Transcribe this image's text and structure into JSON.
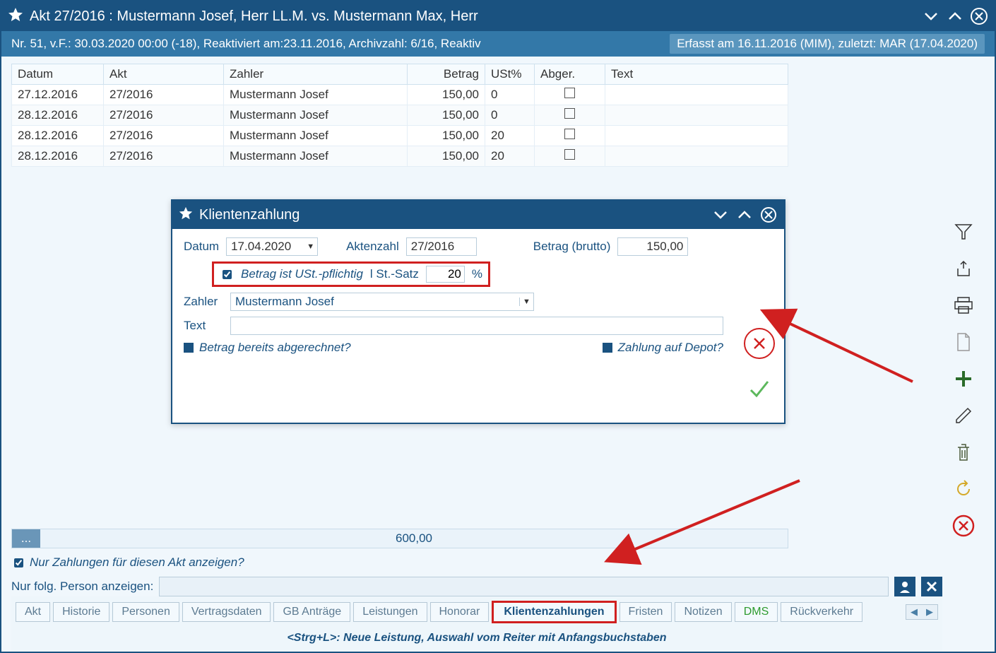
{
  "window": {
    "title": "Akt 27/2016 : Mustermann Josef, Herr  LL.M. vs. Mustermann Max, Herr",
    "subtitle_left": "Nr. 51, v.F.: 30.03.2020 00:00 (-18), Reaktiviert am:23.11.2016, Archivzahl: 6/16, Reaktiv",
    "subtitle_right": "Erfasst am 16.11.2016 (MIM), zuletzt: MAR (17.04.2020)"
  },
  "table": {
    "headers": {
      "datum": "Datum",
      "akt": "Akt",
      "zahler": "Zahler",
      "betrag": "Betrag",
      "ust": "USt%",
      "abger": "Abger.",
      "text": "Text"
    },
    "rows": [
      {
        "datum": "27.12.2016",
        "akt": "27/2016",
        "zahler": "Mustermann Josef",
        "betrag": "150,00",
        "ust": "0",
        "abger": false,
        "text": ""
      },
      {
        "datum": "28.12.2016",
        "akt": "27/2016",
        "zahler": "Mustermann Josef",
        "betrag": "150,00",
        "ust": "0",
        "abger": false,
        "text": ""
      },
      {
        "datum": "28.12.2016",
        "akt": "27/2016",
        "zahler": "Mustermann Josef",
        "betrag": "150,00",
        "ust": "20",
        "abger": false,
        "text": ""
      },
      {
        "datum": "28.12.2016",
        "akt": "27/2016",
        "zahler": "Mustermann Josef",
        "betrag": "150,00",
        "ust": "20",
        "abger": false,
        "text": ""
      }
    ]
  },
  "totals": {
    "dots": "...",
    "sum": "600,00"
  },
  "filters": {
    "only_this_case_checked": true,
    "only_this_case_label": "Nur Zahlungen für diesen Akt anzeigen?",
    "person_label": "Nur folg. Person anzeigen:",
    "person_value": ""
  },
  "tabs": [
    {
      "key": "akt",
      "label": "Akt"
    },
    {
      "key": "historie",
      "label": "Historie"
    },
    {
      "key": "personen",
      "label": "Personen"
    },
    {
      "key": "vertragsdaten",
      "label": "Vertragsdaten"
    },
    {
      "key": "gbantraege",
      "label": "GB Anträge"
    },
    {
      "key": "leistungen",
      "label": "Leistungen"
    },
    {
      "key": "honorar",
      "label": "Honorar"
    },
    {
      "key": "klientenzahlungen",
      "label": "Klientenzahlungen"
    },
    {
      "key": "fristen",
      "label": "Fristen"
    },
    {
      "key": "notizen",
      "label": "Notizen"
    },
    {
      "key": "dms",
      "label": "DMS"
    },
    {
      "key": "rueckverkehr",
      "label": "Rückverkehr"
    }
  ],
  "active_tab": "klientenzahlungen",
  "hint": "<Strg+L>: Neue Leistung, Auswahl vom Reiter mit Anfangsbuchstaben",
  "dialog": {
    "title": "Klientenzahlung",
    "labels": {
      "datum": "Datum",
      "aktenzahl": "Aktenzahl",
      "betrag": "Betrag (brutto)",
      "vat_check": "Betrag ist USt.-pflichtig",
      "vat_rate_label": "l St.-Satz",
      "percent": "%",
      "zahler": "Zahler",
      "text": "Text",
      "q_abger": "Betrag bereits abgerechnet?",
      "q_depot": "Zahlung auf Depot?"
    },
    "values": {
      "datum": "17.04.2020",
      "aktenzahl": "27/2016",
      "betrag": "150,00",
      "vat_checked": true,
      "vat_rate": "20",
      "zahler": "Mustermann Josef",
      "text": ""
    }
  }
}
